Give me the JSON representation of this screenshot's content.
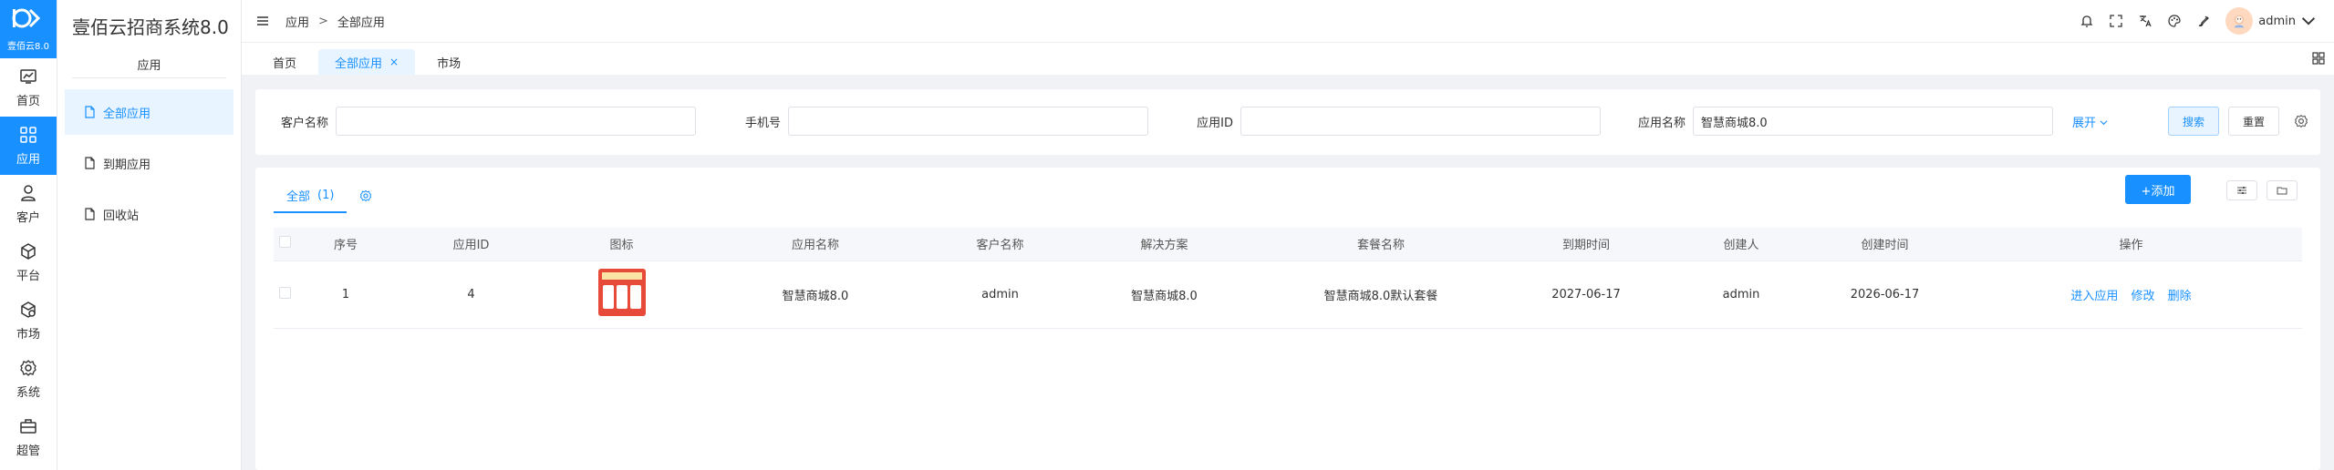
{
  "rail": {
    "logo_text": "壹佰云8.0",
    "items": [
      {
        "label": "首页",
        "icon": "dashboard-icon"
      },
      {
        "label": "应用",
        "icon": "apps-grid-icon"
      },
      {
        "label": "客户",
        "icon": "user-icon"
      },
      {
        "label": "平台",
        "icon": "cube-icon"
      },
      {
        "label": "市场",
        "icon": "market-box-icon"
      },
      {
        "label": "系统",
        "icon": "gear-icon"
      },
      {
        "label": "超管",
        "icon": "toolbox-icon"
      }
    ]
  },
  "sidebar": {
    "brand": "壹佰云招商系统8.0",
    "section": "应用",
    "items": [
      {
        "label": "全部应用"
      },
      {
        "label": "到期应用"
      },
      {
        "label": "回收站"
      }
    ]
  },
  "header": {
    "breadcrumb": [
      "应用",
      "全部应用"
    ],
    "breadcrumb_sep": ">",
    "user": "admin"
  },
  "tabs": [
    {
      "label": "首页"
    },
    {
      "label": "全部应用",
      "close": "×"
    },
    {
      "label": "市场"
    }
  ],
  "filters": {
    "customer_label": "客户名称",
    "customer_value": "",
    "phone_label": "手机号",
    "phone_value": "",
    "appid_label": "应用ID",
    "appid_value": "",
    "appname_label": "应用名称",
    "appname_value": "智慧商城8.0",
    "expand": "展开",
    "search": "搜索",
    "reset": "重置"
  },
  "panel": {
    "tab_all": "全部",
    "tab_count": "(1)",
    "add": "+添加"
  },
  "table": {
    "headers": [
      "序号",
      "应用ID",
      "图标",
      "应用名称",
      "客户名称",
      "解决方案",
      "套餐名称",
      "到期时间",
      "创建人",
      "创建时间",
      "操作"
    ],
    "rows": [
      {
        "no": "1",
        "appid": "4",
        "name": "智慧商城8.0",
        "customer": "admin",
        "solution": "智慧商城8.0",
        "package": "智慧商城8.0默认套餐",
        "expire": "2027-06-17",
        "creator": "admin",
        "created": "2026-06-17",
        "actions": [
          "进入应用",
          "修改",
          "删除"
        ]
      }
    ]
  },
  "colors": {
    "accent": "#1890ff",
    "active_bg": "#e8f4ff"
  }
}
